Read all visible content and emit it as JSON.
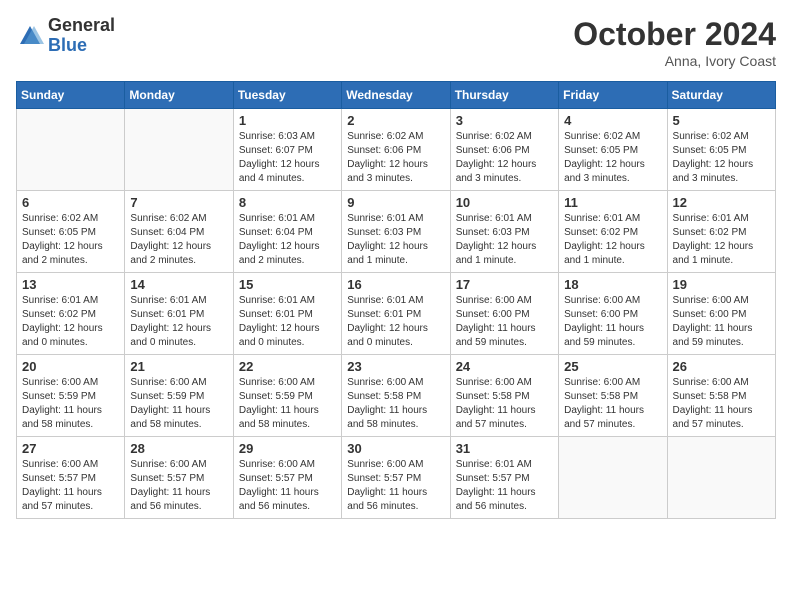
{
  "header": {
    "logo_general": "General",
    "logo_blue": "Blue",
    "month": "October 2024",
    "location": "Anna, Ivory Coast"
  },
  "weekdays": [
    "Sunday",
    "Monday",
    "Tuesday",
    "Wednesday",
    "Thursday",
    "Friday",
    "Saturday"
  ],
  "weeks": [
    [
      {
        "day": "",
        "detail": ""
      },
      {
        "day": "",
        "detail": ""
      },
      {
        "day": "1",
        "detail": "Sunrise: 6:03 AM\nSunset: 6:07 PM\nDaylight: 12 hours\nand 4 minutes."
      },
      {
        "day": "2",
        "detail": "Sunrise: 6:02 AM\nSunset: 6:06 PM\nDaylight: 12 hours\nand 3 minutes."
      },
      {
        "day": "3",
        "detail": "Sunrise: 6:02 AM\nSunset: 6:06 PM\nDaylight: 12 hours\nand 3 minutes."
      },
      {
        "day": "4",
        "detail": "Sunrise: 6:02 AM\nSunset: 6:05 PM\nDaylight: 12 hours\nand 3 minutes."
      },
      {
        "day": "5",
        "detail": "Sunrise: 6:02 AM\nSunset: 6:05 PM\nDaylight: 12 hours\nand 3 minutes."
      }
    ],
    [
      {
        "day": "6",
        "detail": "Sunrise: 6:02 AM\nSunset: 6:05 PM\nDaylight: 12 hours\nand 2 minutes."
      },
      {
        "day": "7",
        "detail": "Sunrise: 6:02 AM\nSunset: 6:04 PM\nDaylight: 12 hours\nand 2 minutes."
      },
      {
        "day": "8",
        "detail": "Sunrise: 6:01 AM\nSunset: 6:04 PM\nDaylight: 12 hours\nand 2 minutes."
      },
      {
        "day": "9",
        "detail": "Sunrise: 6:01 AM\nSunset: 6:03 PM\nDaylight: 12 hours\nand 1 minute."
      },
      {
        "day": "10",
        "detail": "Sunrise: 6:01 AM\nSunset: 6:03 PM\nDaylight: 12 hours\nand 1 minute."
      },
      {
        "day": "11",
        "detail": "Sunrise: 6:01 AM\nSunset: 6:02 PM\nDaylight: 12 hours\nand 1 minute."
      },
      {
        "day": "12",
        "detail": "Sunrise: 6:01 AM\nSunset: 6:02 PM\nDaylight: 12 hours\nand 1 minute."
      }
    ],
    [
      {
        "day": "13",
        "detail": "Sunrise: 6:01 AM\nSunset: 6:02 PM\nDaylight: 12 hours\nand 0 minutes."
      },
      {
        "day": "14",
        "detail": "Sunrise: 6:01 AM\nSunset: 6:01 PM\nDaylight: 12 hours\nand 0 minutes."
      },
      {
        "day": "15",
        "detail": "Sunrise: 6:01 AM\nSunset: 6:01 PM\nDaylight: 12 hours\nand 0 minutes."
      },
      {
        "day": "16",
        "detail": "Sunrise: 6:01 AM\nSunset: 6:01 PM\nDaylight: 12 hours\nand 0 minutes."
      },
      {
        "day": "17",
        "detail": "Sunrise: 6:00 AM\nSunset: 6:00 PM\nDaylight: 11 hours\nand 59 minutes."
      },
      {
        "day": "18",
        "detail": "Sunrise: 6:00 AM\nSunset: 6:00 PM\nDaylight: 11 hours\nand 59 minutes."
      },
      {
        "day": "19",
        "detail": "Sunrise: 6:00 AM\nSunset: 6:00 PM\nDaylight: 11 hours\nand 59 minutes."
      }
    ],
    [
      {
        "day": "20",
        "detail": "Sunrise: 6:00 AM\nSunset: 5:59 PM\nDaylight: 11 hours\nand 58 minutes."
      },
      {
        "day": "21",
        "detail": "Sunrise: 6:00 AM\nSunset: 5:59 PM\nDaylight: 11 hours\nand 58 minutes."
      },
      {
        "day": "22",
        "detail": "Sunrise: 6:00 AM\nSunset: 5:59 PM\nDaylight: 11 hours\nand 58 minutes."
      },
      {
        "day": "23",
        "detail": "Sunrise: 6:00 AM\nSunset: 5:58 PM\nDaylight: 11 hours\nand 58 minutes."
      },
      {
        "day": "24",
        "detail": "Sunrise: 6:00 AM\nSunset: 5:58 PM\nDaylight: 11 hours\nand 57 minutes."
      },
      {
        "day": "25",
        "detail": "Sunrise: 6:00 AM\nSunset: 5:58 PM\nDaylight: 11 hours\nand 57 minutes."
      },
      {
        "day": "26",
        "detail": "Sunrise: 6:00 AM\nSunset: 5:58 PM\nDaylight: 11 hours\nand 57 minutes."
      }
    ],
    [
      {
        "day": "27",
        "detail": "Sunrise: 6:00 AM\nSunset: 5:57 PM\nDaylight: 11 hours\nand 57 minutes."
      },
      {
        "day": "28",
        "detail": "Sunrise: 6:00 AM\nSunset: 5:57 PM\nDaylight: 11 hours\nand 56 minutes."
      },
      {
        "day": "29",
        "detail": "Sunrise: 6:00 AM\nSunset: 5:57 PM\nDaylight: 11 hours\nand 56 minutes."
      },
      {
        "day": "30",
        "detail": "Sunrise: 6:00 AM\nSunset: 5:57 PM\nDaylight: 11 hours\nand 56 minutes."
      },
      {
        "day": "31",
        "detail": "Sunrise: 6:01 AM\nSunset: 5:57 PM\nDaylight: 11 hours\nand 56 minutes."
      },
      {
        "day": "",
        "detail": ""
      },
      {
        "day": "",
        "detail": ""
      }
    ]
  ]
}
